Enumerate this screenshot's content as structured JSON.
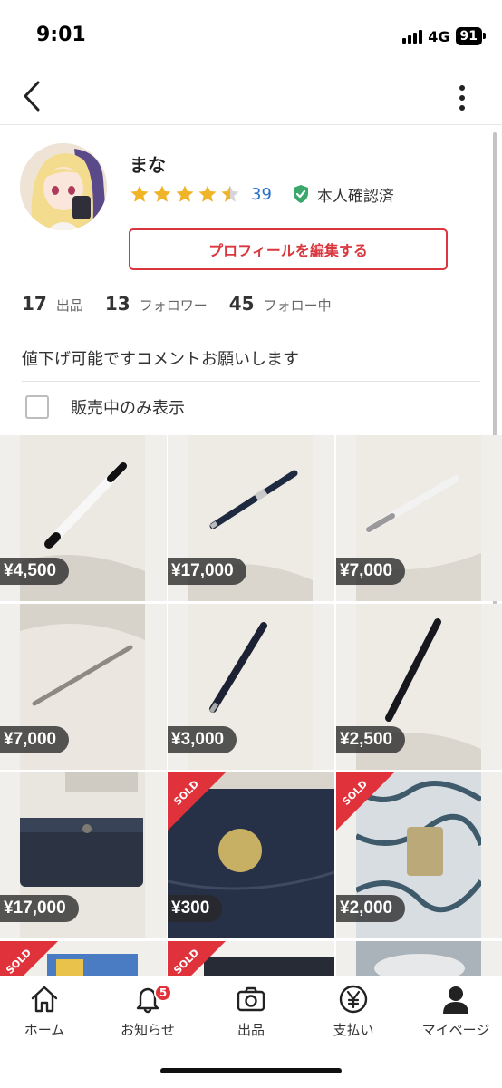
{
  "status_bar": {
    "time": "9:01",
    "network": "4G",
    "battery": "91"
  },
  "profile": {
    "name": "まな",
    "rating_count": "39",
    "rating_stars": 4.5,
    "verified_label": "本人確認済",
    "edit_button": "プロフィールを編集する",
    "stats": [
      {
        "num": "17",
        "label": "出品"
      },
      {
        "num": "13",
        "label": "フォロワー"
      },
      {
        "num": "45",
        "label": "フォロー中"
      }
    ],
    "bio": "値下げ可能ですコメントお願いします",
    "filter_label": "販売中のみ表示"
  },
  "items": [
    {
      "price": "¥4,500",
      "sold": false,
      "sold_label": ""
    },
    {
      "price": "¥17,000",
      "sold": false,
      "sold_label": ""
    },
    {
      "price": "¥7,000",
      "sold": false,
      "sold_label": ""
    },
    {
      "price": "¥7,000",
      "sold": false,
      "sold_label": ""
    },
    {
      "price": "¥3,000",
      "sold": false,
      "sold_label": ""
    },
    {
      "price": "¥2,500",
      "sold": false,
      "sold_label": ""
    },
    {
      "price": "¥17,000",
      "sold": false,
      "sold_label": ""
    },
    {
      "price": "¥300",
      "sold": true,
      "sold_label": "SOLD"
    },
    {
      "price": "¥2,000",
      "sold": true,
      "sold_label": "SOLD"
    },
    {
      "price": "",
      "sold": true,
      "sold_label": "SOLD"
    },
    {
      "price": "",
      "sold": true,
      "sold_label": "SOLD"
    },
    {
      "price": "",
      "sold": false,
      "sold_label": ""
    }
  ],
  "tabbar": {
    "tabs": [
      {
        "label": "ホーム",
        "icon": "home-icon"
      },
      {
        "label": "お知らせ",
        "icon": "bell-icon",
        "badge": "5"
      },
      {
        "label": "出品",
        "icon": "camera-icon"
      },
      {
        "label": "支払い",
        "icon": "yen-icon"
      },
      {
        "label": "マイページ",
        "icon": "person-icon"
      }
    ]
  },
  "colors": {
    "accent": "#d9363e",
    "star": "#f0b429",
    "link": "#2a6fc9",
    "verified": "#3aa76d"
  }
}
